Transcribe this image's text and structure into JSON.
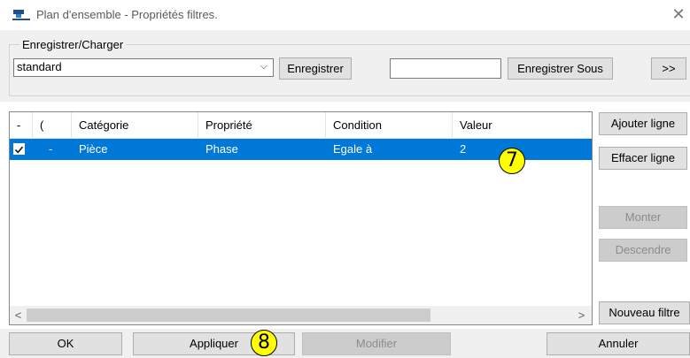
{
  "window": {
    "title": "Plan d'ensemble - Propriétés filtres.",
    "icon": "app-filter-icon",
    "close_glyph": "✕"
  },
  "save_load": {
    "legend": "Enregistrer/Charger",
    "combo_value": "standard",
    "save_label": "Enregistrer",
    "name_value": "",
    "save_as_label": "Enregistrer Sous",
    "more_label": ">>"
  },
  "grid": {
    "columns": [
      "-",
      "(",
      "Catégorie",
      "Propriété",
      "Condition",
      "Valeur"
    ],
    "rows": [
      {
        "checked": true,
        "paren": "-",
        "categorie": "Pièce",
        "propriete": "Phase",
        "condition": "Egale à",
        "valeur": "2"
      }
    ]
  },
  "side_buttons": {
    "add_line": "Ajouter ligne",
    "clear_line": "Effacer ligne",
    "move_up": "Monter",
    "move_down": "Descendre",
    "new_filter": "Nouveau filtre"
  },
  "footer": {
    "ok": "OK",
    "apply": "Appliquer",
    "modify": "Modifier",
    "cancel": "Annuler"
  },
  "annotations": {
    "callout_7": "7",
    "callout_8": "8"
  },
  "colors": {
    "selection": "#0078d7",
    "callout_fill": "#ffff00",
    "dialog_bg": "#f0f0f0"
  }
}
